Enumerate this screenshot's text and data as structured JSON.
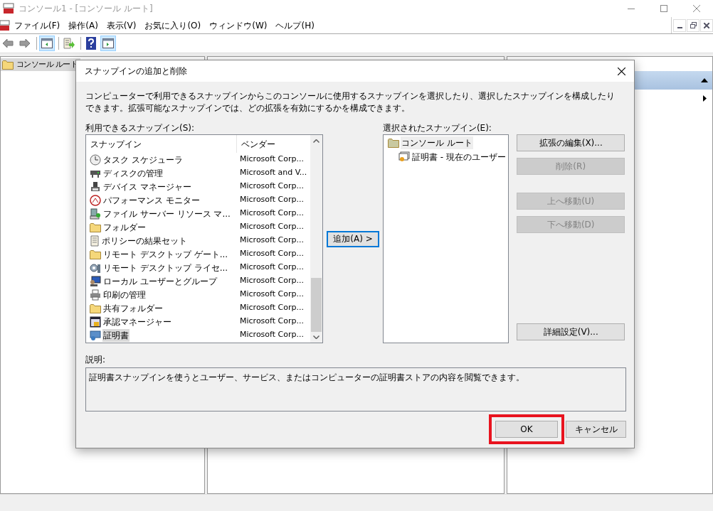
{
  "window": {
    "title": "コンソール1 - [コンソール ルート]"
  },
  "menu": [
    "ファイル(F)",
    "操作(A)",
    "表示(V)",
    "お気に入り(O)",
    "ウィンドウ(W)",
    "ヘルプ(H)"
  ],
  "toolbar": [
    {
      "kind": "back",
      "pressed": false
    },
    {
      "kind": "forward",
      "pressed": false
    },
    {
      "kind": "tree",
      "pressed": true
    },
    {
      "kind": "export",
      "pressed": false
    },
    {
      "kind": "help",
      "pressed": false
    },
    {
      "kind": "actions",
      "pressed": true
    }
  ],
  "tree": {
    "root": {
      "label": "コンソール ルート",
      "selected": true
    }
  },
  "dialog": {
    "title": "スナップインの追加と削除",
    "intro": "コンピューターで利用できるスナップインからこのコンソールに使用するスナップインを選択したり、選択したスナップインを構成したりできます。拡張可能なスナップインでは、どの拡張を有効にするかを構成できます。",
    "available_label": "利用できるスナップイン(S):",
    "columns": [
      "スナップイン",
      "ベンダー"
    ],
    "snapins": [
      {
        "name": "タスク スケジューラ",
        "vendor": "Microsoft Corp...",
        "selected": false
      },
      {
        "name": "ディスクの管理",
        "vendor": "Microsoft and V...",
        "selected": false
      },
      {
        "name": "デバイス マネージャー",
        "vendor": "Microsoft Corp...",
        "selected": false
      },
      {
        "name": "パフォーマンス モニター",
        "vendor": "Microsoft Corp...",
        "selected": false
      },
      {
        "name": "ファイル サーバー リソース マ...",
        "vendor": "Microsoft Corp...",
        "selected": false
      },
      {
        "name": "フォルダー",
        "vendor": "Microsoft Corp...",
        "selected": false
      },
      {
        "name": "ポリシーの結果セット",
        "vendor": "Microsoft Corp...",
        "selected": false
      },
      {
        "name": "リモート デスクトップ ゲート...",
        "vendor": "Microsoft Corp...",
        "selected": false
      },
      {
        "name": "リモート デスクトップ ライセ...",
        "vendor": "Microsoft Corp...",
        "selected": false
      },
      {
        "name": "ローカル ユーザーとグループ",
        "vendor": "Microsoft Corp...",
        "selected": false
      },
      {
        "name": "印刷の管理",
        "vendor": "Microsoft Corp...",
        "selected": false
      },
      {
        "name": "共有フォルダー",
        "vendor": "Microsoft Corp...",
        "selected": false
      },
      {
        "name": "承認マネージャー",
        "vendor": "Microsoft Corp...",
        "selected": false
      },
      {
        "name": "証明書",
        "vendor": "Microsoft Corp...",
        "selected": true
      }
    ],
    "add_button": {
      "label": "追加(A) >",
      "focused": true
    },
    "selected_label": "選択されたスナップイン(E):",
    "selected_tree": {
      "label": "コンソール ルート",
      "selected": true,
      "children": [
        {
          "label": "証明書 - 現在のユーザー",
          "selected": false
        }
      ]
    },
    "side_buttons": [
      {
        "label": "拡張の編集(X)...",
        "disabled": false
      },
      {
        "label": "削除(R)",
        "disabled": true
      },
      {
        "label": "上へ移動(U)",
        "disabled": true
      },
      {
        "label": "下へ移動(D)",
        "disabled": true
      },
      {
        "label": "詳細設定(V)...",
        "disabled": false
      }
    ],
    "description_label": "説明:",
    "description": "証明書スナップインを使うとユーザー、サービス、またはコンピューターの証明書ストアの内容を閲覧できます。",
    "ok": {
      "label": "OK",
      "highlighted": true
    },
    "cancel": {
      "label": "キャンセル"
    }
  }
}
